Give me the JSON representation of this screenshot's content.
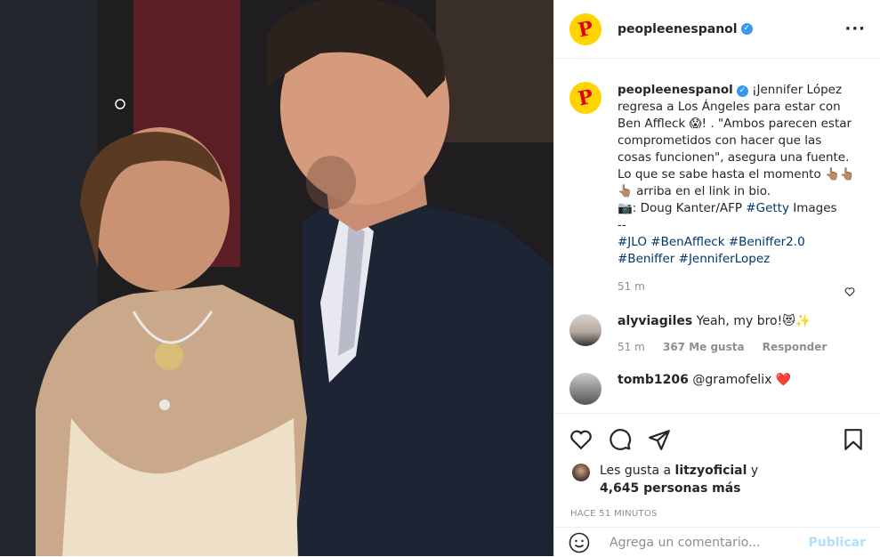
{
  "post": {
    "username": "peopleenespanol",
    "avatar_letter": "P",
    "more_icon": "more-horizontal-icon",
    "colors": {
      "brand_yellow": "#ffd400",
      "brand_red": "#e0001b",
      "verified_blue": "#3897f0",
      "link_blue": "#00376b",
      "publish_disabled": "#b2dffc"
    }
  },
  "caption": {
    "username": "peopleenespanol",
    "text_1": "¡Jennifer López regresa a Los Ángeles para estar con Ben Affleck 😱! . \"Ambos parecen estar comprometidos con hacer que las cosas funcionen\", asegura una fuente. Lo que se sabe hasta el momento 👆🏽👆🏽👆🏽 arriba en el link in bio.",
    "text_2": "📷: Doug Kanter/AFP ",
    "getty_tag": "#Getty",
    "text_3": " Images",
    "separator": "--",
    "hashtags": [
      "#JLO",
      "#BenAffleck",
      "#Beniffer2.0",
      "#Beniffer",
      "#JenniferLopez"
    ],
    "time": "51 m"
  },
  "comments": [
    {
      "username": "alyviagiles",
      "text": "Yeah, my bro!😻✨",
      "time": "51 m",
      "likes": "367 Me gusta",
      "reply": "Responder"
    },
    {
      "username": "tomb1206",
      "text": "@gramofelix ❤️"
    }
  ],
  "actions": {
    "like_icon": "heart-icon",
    "comment_icon": "comment-icon",
    "share_icon": "paper-plane-icon",
    "save_icon": "bookmark-icon"
  },
  "likes": {
    "prefix": "Les gusta a ",
    "user": "litzyoficial",
    "middle": " y",
    "count": "4,645 personas más"
  },
  "posted_ago": "HACE 51 MINUTOS",
  "add_comment": {
    "placeholder": "Agrega un comentario...",
    "publish_label": "Publicar",
    "emoji_icon": "smiley-icon"
  }
}
